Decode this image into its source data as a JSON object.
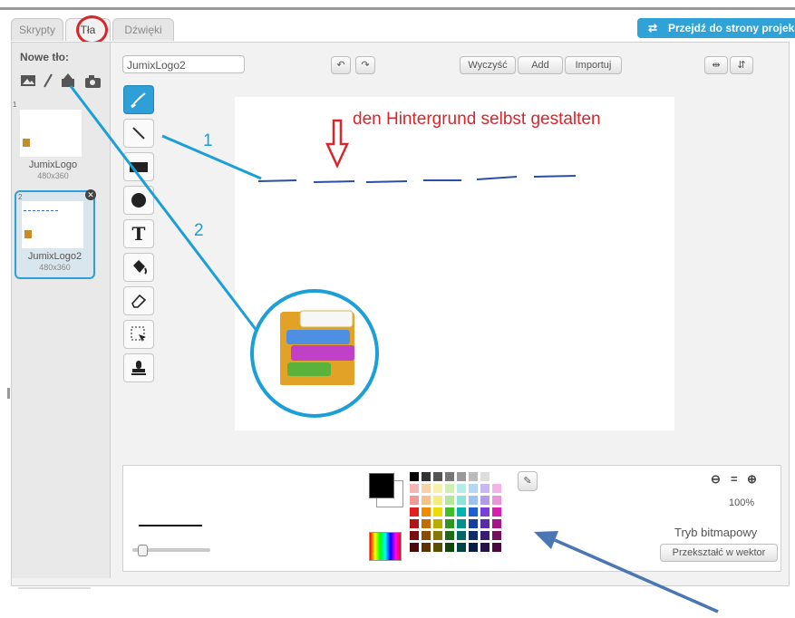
{
  "tabs": [
    {
      "label": "Skrypty"
    },
    {
      "label": "Tła"
    },
    {
      "label": "Dźwięki"
    }
  ],
  "header": {
    "project_button": "Przejdź do strony projek"
  },
  "left": {
    "new_backdrop_label": "Nowe tło:",
    "backdrops": [
      {
        "index": "1",
        "name": "JumixLogo",
        "size": "480x360"
      },
      {
        "index": "2",
        "name": "JumixLogo2",
        "size": "480x360"
      }
    ]
  },
  "editor": {
    "name_value": "JumixLogo2",
    "clear_label": "Wyczyść",
    "add_label": "Add",
    "import_label": "Importuj"
  },
  "annotations": {
    "canvas_text": "den Hintergrund selbst gestalten",
    "num1": "1",
    "num2": "2"
  },
  "bottom": {
    "zoom": "100%",
    "mode_label": "Tryb bitmapowy",
    "convert_label": "Przekształć w wektor"
  },
  "colors": {
    "accent": "#2f9fd8",
    "annotation_blue": "#1b9fd6",
    "annotation_red": "#d8262b"
  }
}
